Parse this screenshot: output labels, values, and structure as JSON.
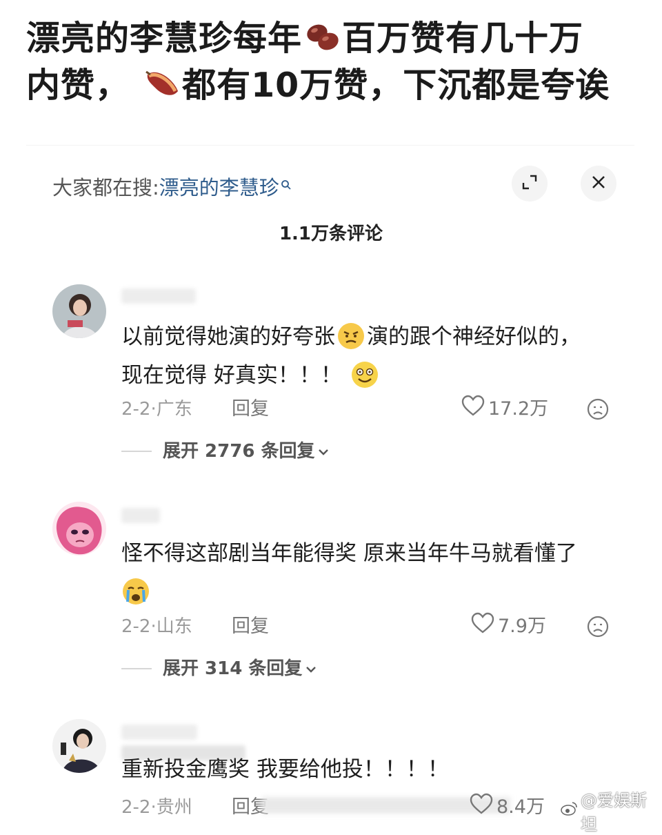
{
  "headline": {
    "part1": "漂亮的李慧珍每年",
    "part2": "百万赞有几十万",
    "part3": "内赞，",
    "part4": "都有10万赞，下沉都是夸诶"
  },
  "search": {
    "prefix": "大家都在搜:",
    "term": "漂亮的李慧珍"
  },
  "comments_count": "1.1万条评论",
  "comments": [
    {
      "text1": "以前觉得她演的好夸张",
      "text2": "演的跟个神经好似的，",
      "text3": "现在觉得  好真实！！！",
      "date_location": "2-2·广东",
      "reply": "回复",
      "likes": "17.2万",
      "expand": "展开 2776 条回复"
    },
    {
      "text1": "怪不得这部剧当年能得奖 原来当年牛马就看懂了",
      "date_location": "2-2·山东",
      "reply": "回复",
      "likes": "7.9万",
      "expand": "展开 314 条回复"
    },
    {
      "text1": "重新投金鹰奖 我要给他投！！！！",
      "date_location": "2-2·贵州",
      "reply": "回复",
      "likes": "8.4万"
    }
  ],
  "watermark": "@爱娱斯坦",
  "colors": {
    "link": "#2f5c8c",
    "muted": "#9a9a9a",
    "text": "#1e1e1e"
  },
  "icons": [
    "bean-emoji-icon",
    "sweet-potato-emoji-icon",
    "search-icon",
    "expand-icon",
    "close-icon",
    "avatar",
    "angry-emoji-icon",
    "smile-emoji-icon",
    "cry-emoji-icon",
    "heart-icon",
    "dislike-icon",
    "chevron-down-icon",
    "weibo-icon"
  ]
}
